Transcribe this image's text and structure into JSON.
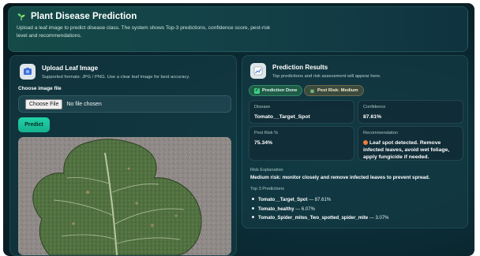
{
  "header": {
    "title": "Plant Disease Prediction",
    "description": "Upload a leaf image to predict disease class. The system shows Top-3 predictions, confidence score, pest-risk level and recommendations."
  },
  "upload": {
    "title": "Upload Leaf Image",
    "subtitle": "Supported formats: JPG / PNG. Use a clear leaf image for best accuracy.",
    "choose_label": "Choose image file",
    "file_button": "Choose File",
    "file_status": "No file chosen",
    "predict_button": "Predict"
  },
  "results": {
    "title": "Prediction Results",
    "subtitle": "Top predictions and risk assessment will appear here.",
    "badge_done": "Prediction Done",
    "badge_risk": "Pest Risk: Medium",
    "disease_label": "Disease",
    "disease_value": "Tomato__Target_Spot",
    "confidence_label": "Confidence",
    "confidence_value": "87.61%",
    "pest_risk_label": "Pest Risk %",
    "pest_risk_value": "75.34%",
    "recommendation_label": "Recommendation",
    "recommendation_value": "Leaf spot detected. Remove infected leaves, avoid wet foliage, apply fungicide if needed.",
    "risk_explanation_label": "Risk Explanation",
    "risk_explanation_value": "Medium risk: monitor closely and remove infected leaves to prevent spread.",
    "top3_label": "Top 3 Predictions",
    "top3": [
      {
        "name": "Tomato__Target_Spot",
        "score": " — 87.61%"
      },
      {
        "name": "Tomato_healthy",
        "score": " — 6.07%"
      },
      {
        "name": "Tomato_Spider_mites_Two_spotted_spider_mite",
        "score": " — 3.07%"
      }
    ]
  },
  "colors": {
    "accent": "#22d3a8",
    "background": "#0b2a33",
    "risk_medium": "#f07d3c"
  },
  "icons": {
    "header": "sprout-icon",
    "upload": "image-upload-icon",
    "results": "chart-icon",
    "done": "check-icon",
    "risk": "bug-icon",
    "recommendation": "warning-dot-icon"
  }
}
